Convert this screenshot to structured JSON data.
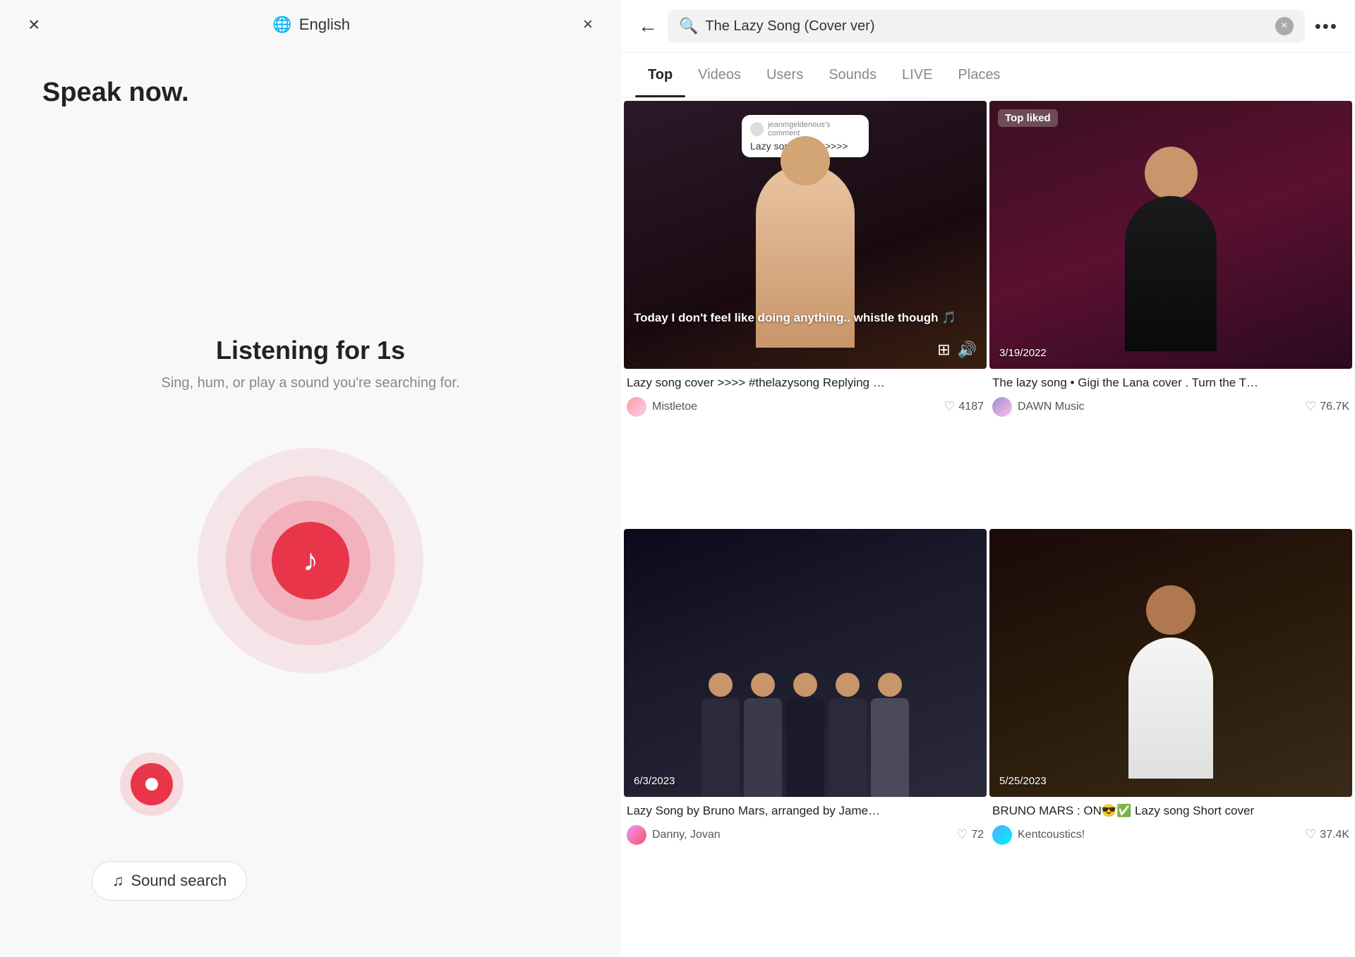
{
  "left_panel": {
    "close_label": "×",
    "language": {
      "globe": "🌐",
      "label": "English",
      "close": "×"
    },
    "speak_now": "Speak now.",
    "listening_title": "Listening for 1s",
    "listening_subtitle": "Sing, hum, or play a sound you're searching for.",
    "sound_search_label": "Sound search",
    "music_note": "♪"
  },
  "right_panel": {
    "back_label": "←",
    "search_value": "The Lazy Song (Cover ver)",
    "more_label": "•••",
    "tabs": [
      {
        "label": "Top",
        "active": true
      },
      {
        "label": "Videos",
        "active": false
      },
      {
        "label": "Users",
        "active": false
      },
      {
        "label": "Sounds",
        "active": false
      },
      {
        "label": "LIVE",
        "active": false
      },
      {
        "label": "Places",
        "active": false
      }
    ],
    "videos": [
      {
        "id": "v1",
        "thumbnail_class": "thumb-1",
        "top_liked": false,
        "has_comment_bubble": true,
        "bubble_user": "jeanmgeldenous's comment",
        "bubble_text": "Lazy song cover >>>>",
        "caption": "Today I don't feel like doing anything.. whistle though 🎵",
        "date": "",
        "title": "Lazy song cover >>>> #thelazysong Replying …",
        "author": "Mistletoe",
        "author_av_class": "av-mistletoe",
        "likes": "4187",
        "has_icons": true
      },
      {
        "id": "v2",
        "thumbnail_class": "thumb-2",
        "top_liked": true,
        "top_liked_label": "Top liked",
        "has_comment_bubble": false,
        "caption": "",
        "date": "3/19/2022",
        "title": "The lazy song • Gigi the Lana cover . Turn the T…",
        "author": "DAWN Music",
        "author_av_class": "av-dawn",
        "likes": "76.7K",
        "has_icons": false
      },
      {
        "id": "v3",
        "thumbnail_class": "thumb-3",
        "top_liked": false,
        "has_comment_bubble": false,
        "caption": "",
        "date": "6/3/2023",
        "title": "Lazy Song by Bruno Mars, arranged by Jame…",
        "author": "Danny, Jovan",
        "author_av_class": "av-danny",
        "likes": "72",
        "has_icons": false
      },
      {
        "id": "v4",
        "thumbnail_class": "thumb-4",
        "top_liked": false,
        "has_comment_bubble": false,
        "caption": "",
        "date": "5/25/2023",
        "title": "BRUNO MARS : ON😎✅ Lazy song Short cover",
        "author": "Kentcoustics!",
        "author_av_class": "av-kent",
        "likes": "37.4K",
        "has_icons": false
      }
    ]
  }
}
